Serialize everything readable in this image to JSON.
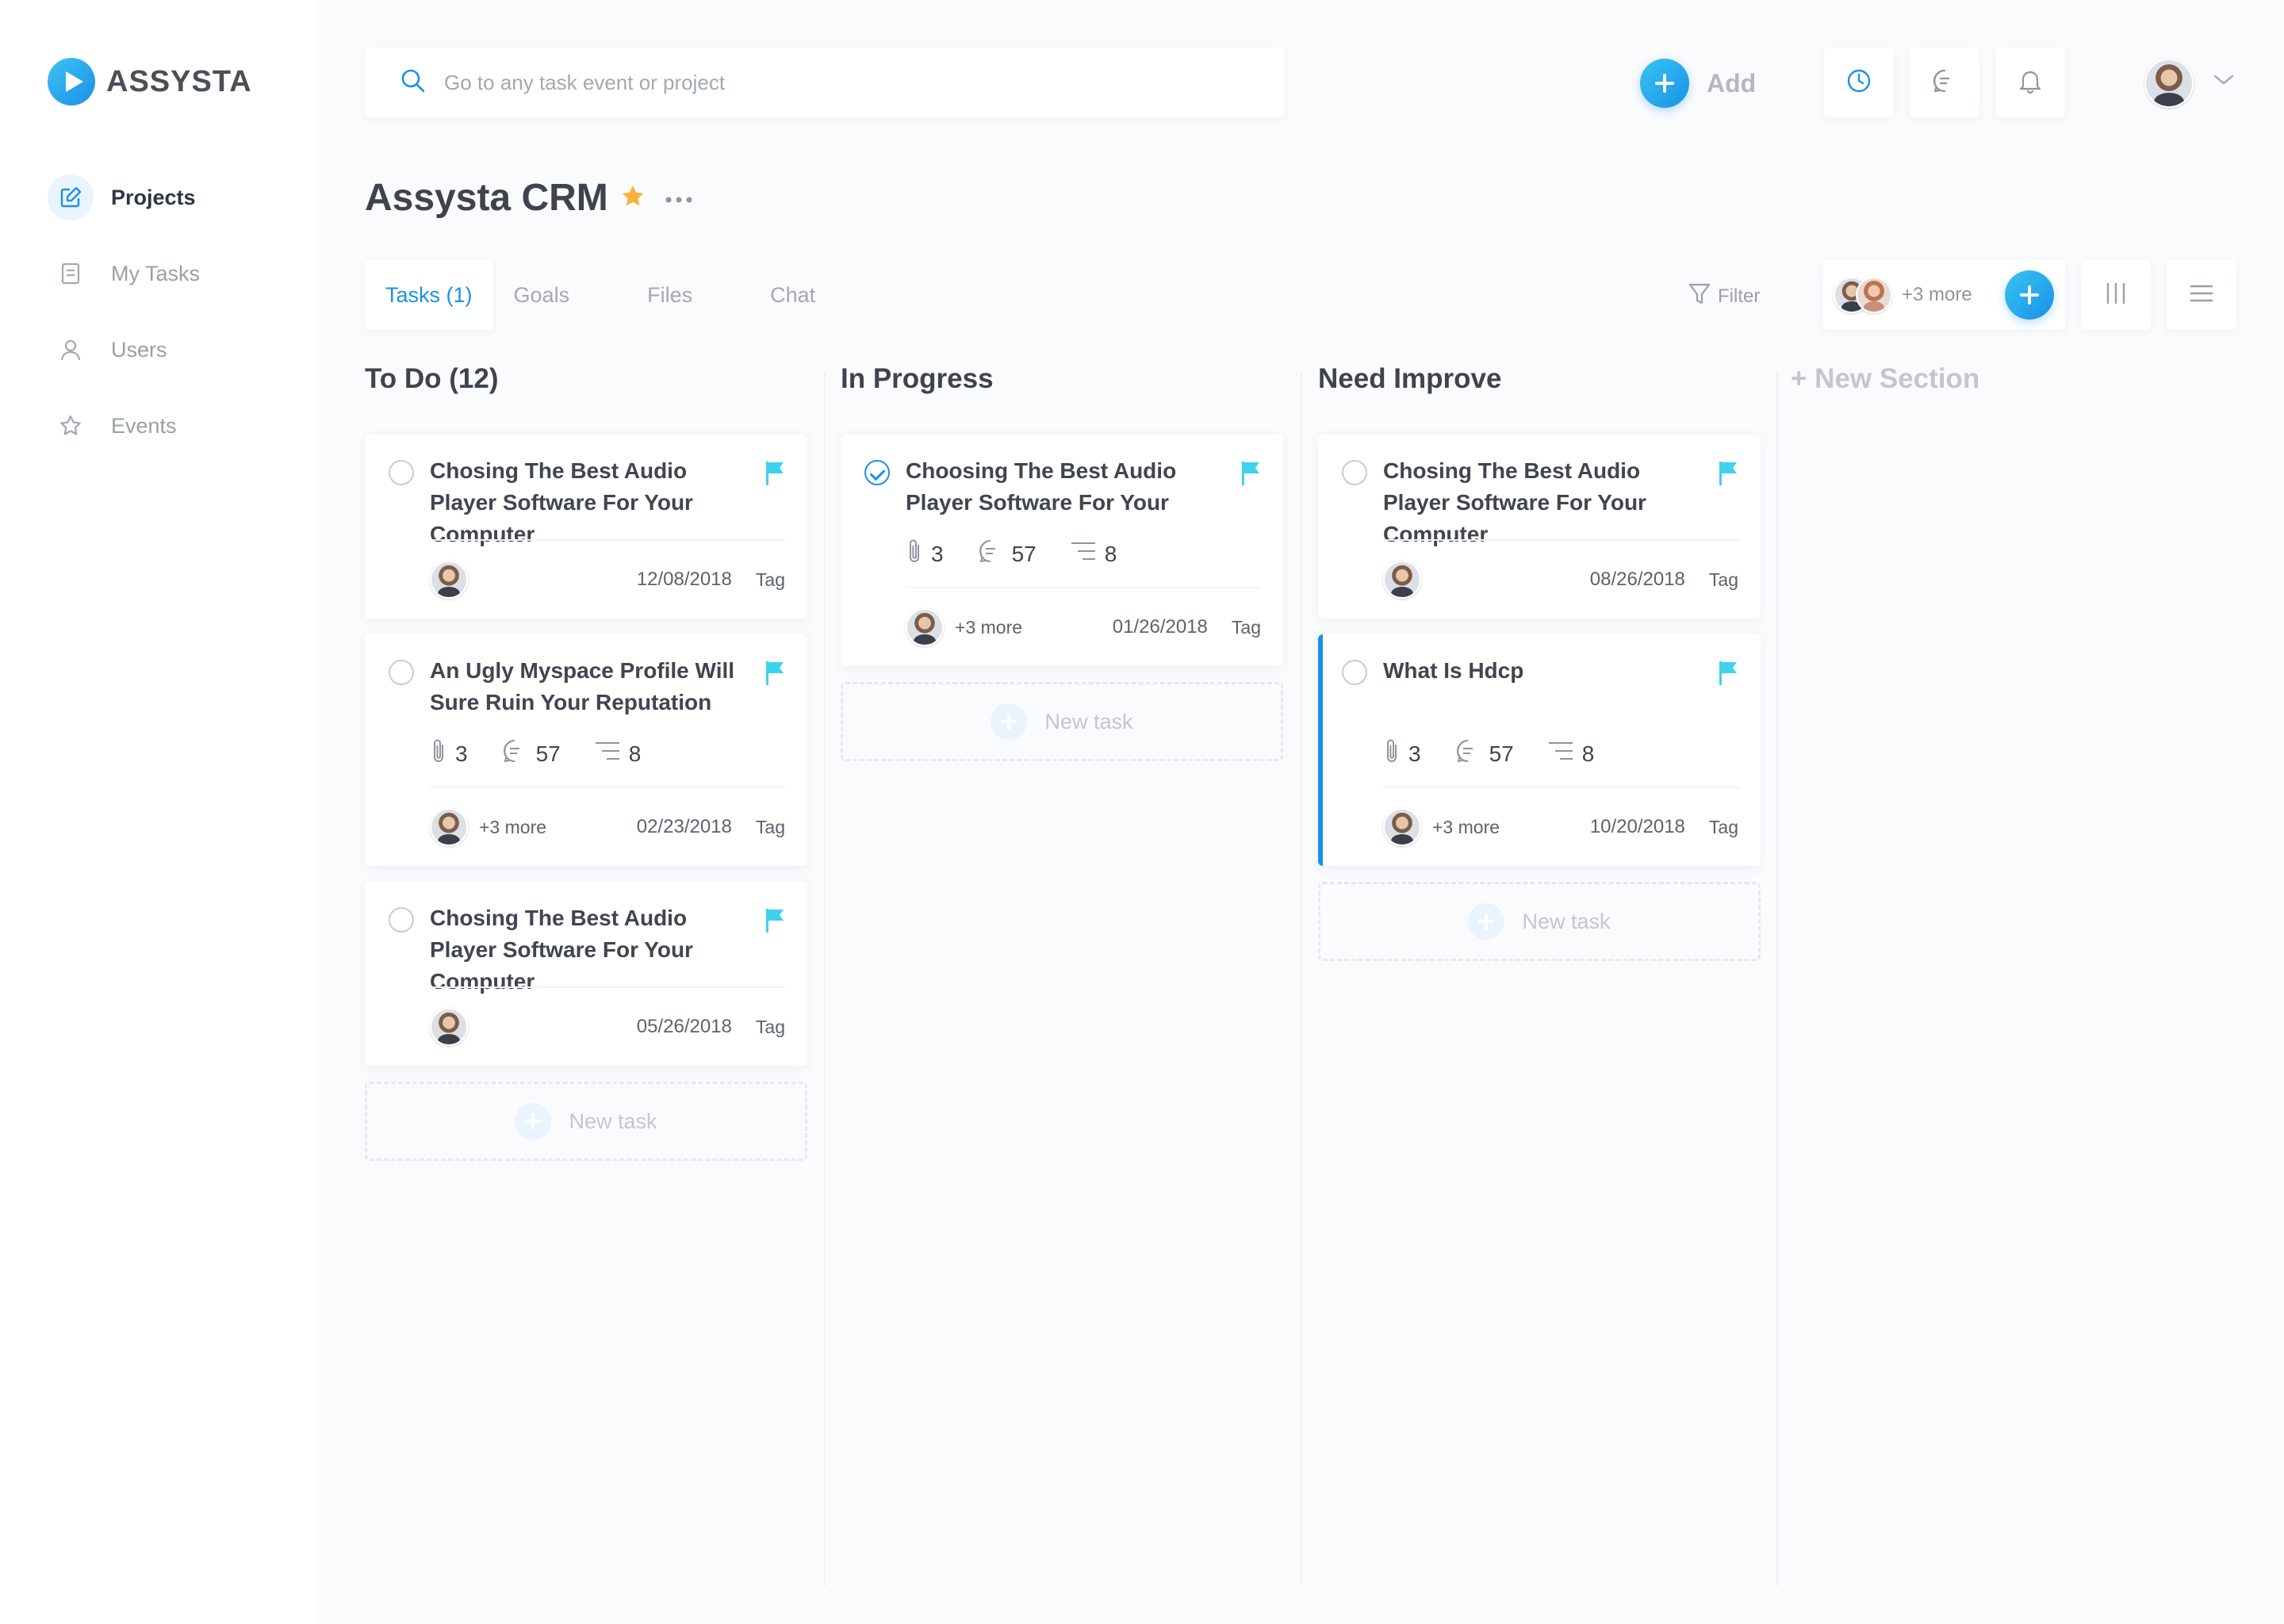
{
  "brand": {
    "name": "ASSYSTA",
    "accent": "#1a91e8",
    "flag_color": "#3dd3ec",
    "star_color": "#f7b23b"
  },
  "sidebar": {
    "items": [
      {
        "label": "Projects",
        "icon": "edit-icon",
        "active": true
      },
      {
        "label": "My Tasks",
        "icon": "document-icon",
        "active": false
      },
      {
        "label": "Users",
        "icon": "user-icon",
        "active": false
      },
      {
        "label": "Events",
        "icon": "star-outline-icon",
        "active": false
      }
    ]
  },
  "topbar": {
    "search_placeholder": "Go to any task event or project",
    "add_label": "Add",
    "icons": [
      "clock-icon",
      "chat-icon",
      "bell-icon"
    ]
  },
  "project": {
    "title": "Assysta CRM",
    "tabs": [
      "Tasks (1)",
      "Goals",
      "Files",
      "Chat"
    ],
    "filter_label": "Filter",
    "members_more": "+3 more"
  },
  "columns": [
    {
      "title": "To Do (12)",
      "cards": [
        {
          "title": "Chosing The Best Audio Player Software For Your Computer",
          "date": "12/08/2018",
          "tag": "Tag"
        },
        {
          "title": "An Ugly Myspace Profile Will Sure Ruin Your Reputation",
          "attachments": "3",
          "comments": "57",
          "subtasks": "8",
          "more": "+3 more",
          "date": "02/23/2018",
          "tag": "Tag"
        },
        {
          "title": "Chosing The Best Audio Player Software For Your Computer",
          "date": "05/26/2018",
          "tag": "Tag"
        }
      ],
      "new_task": "New task"
    },
    {
      "title": "In Progress",
      "cards": [
        {
          "title": "Choosing The Best Audio Player Software For Your",
          "attachments": "3",
          "comments": "57",
          "subtasks": "8",
          "more": "+3 more",
          "date": "01/26/2018",
          "tag": "Tag",
          "done": true
        }
      ],
      "new_task": "New task"
    },
    {
      "title": "Need Improve",
      "cards": [
        {
          "title": "Chosing The Best Audio Player Software For Your Computer",
          "date": "08/26/2018",
          "tag": "Tag"
        },
        {
          "title": "What Is Hdcp",
          "attachments": "3",
          "comments": "57",
          "subtasks": "8",
          "more": "+3 more",
          "date": "10/20/2018",
          "tag": "Tag"
        }
      ],
      "new_task": "New task"
    }
  ],
  "new_section": "+ New Section"
}
